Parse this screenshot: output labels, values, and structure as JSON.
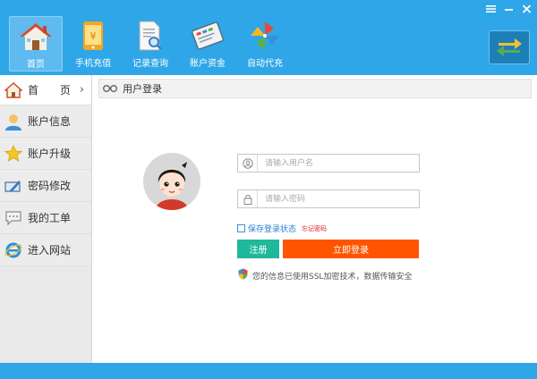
{
  "window": {
    "menu_icon": "menu-icon",
    "minimize_icon": "minimize-icon",
    "close_icon": "close-icon"
  },
  "toolbar": {
    "items": [
      {
        "label": "首页",
        "icon": "house-icon"
      },
      {
        "label": "手机充值",
        "icon": "phone-icon"
      },
      {
        "label": "记录查询",
        "icon": "document-search-icon"
      },
      {
        "label": "账户资金",
        "icon": "ledger-icon"
      },
      {
        "label": "自动代充",
        "icon": "pinwheel-icon"
      }
    ],
    "switch_icon": "swap-arrows-icon"
  },
  "sidebar": {
    "items": [
      {
        "label": "首 页",
        "icon": "house-icon"
      },
      {
        "label": "账户信息",
        "icon": "user-icon"
      },
      {
        "label": "账户升级",
        "icon": "star-icon"
      },
      {
        "label": "密码修改",
        "icon": "password-edit-icon"
      },
      {
        "label": "我的工单",
        "icon": "chat-bubble-icon"
      },
      {
        "label": "进入网站",
        "icon": "ie-icon"
      }
    ]
  },
  "content": {
    "title": "用户登录",
    "title_icon": "binoculars-icon"
  },
  "login": {
    "username_placeholder": "请输入用户名",
    "password_placeholder": "请输入密码",
    "remember_label": "保存登录状态",
    "forgot_label": "忘记密码",
    "register_label": "注册",
    "login_label": "立即登录",
    "security_note": "您的信息已使用SSL加密技术，数据传输安全"
  },
  "colors": {
    "primary": "#2fa6e8",
    "login_button": "#ff5500",
    "register_button": "#20b89a",
    "forgot_text": "#e02020"
  }
}
